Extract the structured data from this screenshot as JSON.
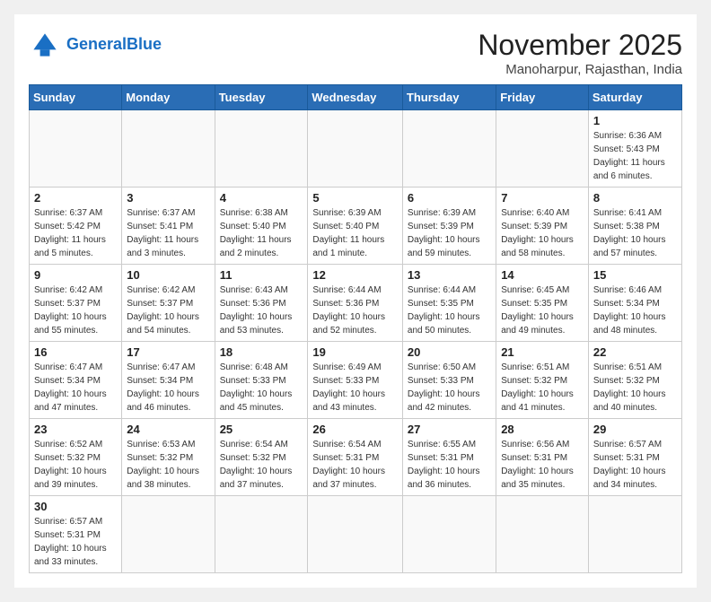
{
  "header": {
    "logo_general": "General",
    "logo_blue": "Blue",
    "month_title": "November 2025",
    "subtitle": "Manoharpur, Rajasthan, India"
  },
  "days_of_week": [
    "Sunday",
    "Monday",
    "Tuesday",
    "Wednesday",
    "Thursday",
    "Friday",
    "Saturday"
  ],
  "weeks": [
    [
      {
        "day": "",
        "info": ""
      },
      {
        "day": "",
        "info": ""
      },
      {
        "day": "",
        "info": ""
      },
      {
        "day": "",
        "info": ""
      },
      {
        "day": "",
        "info": ""
      },
      {
        "day": "",
        "info": ""
      },
      {
        "day": "1",
        "info": "Sunrise: 6:36 AM\nSunset: 5:43 PM\nDaylight: 11 hours\nand 6 minutes."
      }
    ],
    [
      {
        "day": "2",
        "info": "Sunrise: 6:37 AM\nSunset: 5:42 PM\nDaylight: 11 hours\nand 5 minutes."
      },
      {
        "day": "3",
        "info": "Sunrise: 6:37 AM\nSunset: 5:41 PM\nDaylight: 11 hours\nand 3 minutes."
      },
      {
        "day": "4",
        "info": "Sunrise: 6:38 AM\nSunset: 5:40 PM\nDaylight: 11 hours\nand 2 minutes."
      },
      {
        "day": "5",
        "info": "Sunrise: 6:39 AM\nSunset: 5:40 PM\nDaylight: 11 hours\nand 1 minute."
      },
      {
        "day": "6",
        "info": "Sunrise: 6:39 AM\nSunset: 5:39 PM\nDaylight: 10 hours\nand 59 minutes."
      },
      {
        "day": "7",
        "info": "Sunrise: 6:40 AM\nSunset: 5:39 PM\nDaylight: 10 hours\nand 58 minutes."
      },
      {
        "day": "8",
        "info": "Sunrise: 6:41 AM\nSunset: 5:38 PM\nDaylight: 10 hours\nand 57 minutes."
      }
    ],
    [
      {
        "day": "9",
        "info": "Sunrise: 6:42 AM\nSunset: 5:37 PM\nDaylight: 10 hours\nand 55 minutes."
      },
      {
        "day": "10",
        "info": "Sunrise: 6:42 AM\nSunset: 5:37 PM\nDaylight: 10 hours\nand 54 minutes."
      },
      {
        "day": "11",
        "info": "Sunrise: 6:43 AM\nSunset: 5:36 PM\nDaylight: 10 hours\nand 53 minutes."
      },
      {
        "day": "12",
        "info": "Sunrise: 6:44 AM\nSunset: 5:36 PM\nDaylight: 10 hours\nand 52 minutes."
      },
      {
        "day": "13",
        "info": "Sunrise: 6:44 AM\nSunset: 5:35 PM\nDaylight: 10 hours\nand 50 minutes."
      },
      {
        "day": "14",
        "info": "Sunrise: 6:45 AM\nSunset: 5:35 PM\nDaylight: 10 hours\nand 49 minutes."
      },
      {
        "day": "15",
        "info": "Sunrise: 6:46 AM\nSunset: 5:34 PM\nDaylight: 10 hours\nand 48 minutes."
      }
    ],
    [
      {
        "day": "16",
        "info": "Sunrise: 6:47 AM\nSunset: 5:34 PM\nDaylight: 10 hours\nand 47 minutes."
      },
      {
        "day": "17",
        "info": "Sunrise: 6:47 AM\nSunset: 5:34 PM\nDaylight: 10 hours\nand 46 minutes."
      },
      {
        "day": "18",
        "info": "Sunrise: 6:48 AM\nSunset: 5:33 PM\nDaylight: 10 hours\nand 45 minutes."
      },
      {
        "day": "19",
        "info": "Sunrise: 6:49 AM\nSunset: 5:33 PM\nDaylight: 10 hours\nand 43 minutes."
      },
      {
        "day": "20",
        "info": "Sunrise: 6:50 AM\nSunset: 5:33 PM\nDaylight: 10 hours\nand 42 minutes."
      },
      {
        "day": "21",
        "info": "Sunrise: 6:51 AM\nSunset: 5:32 PM\nDaylight: 10 hours\nand 41 minutes."
      },
      {
        "day": "22",
        "info": "Sunrise: 6:51 AM\nSunset: 5:32 PM\nDaylight: 10 hours\nand 40 minutes."
      }
    ],
    [
      {
        "day": "23",
        "info": "Sunrise: 6:52 AM\nSunset: 5:32 PM\nDaylight: 10 hours\nand 39 minutes."
      },
      {
        "day": "24",
        "info": "Sunrise: 6:53 AM\nSunset: 5:32 PM\nDaylight: 10 hours\nand 38 minutes."
      },
      {
        "day": "25",
        "info": "Sunrise: 6:54 AM\nSunset: 5:32 PM\nDaylight: 10 hours\nand 37 minutes."
      },
      {
        "day": "26",
        "info": "Sunrise: 6:54 AM\nSunset: 5:31 PM\nDaylight: 10 hours\nand 37 minutes."
      },
      {
        "day": "27",
        "info": "Sunrise: 6:55 AM\nSunset: 5:31 PM\nDaylight: 10 hours\nand 36 minutes."
      },
      {
        "day": "28",
        "info": "Sunrise: 6:56 AM\nSunset: 5:31 PM\nDaylight: 10 hours\nand 35 minutes."
      },
      {
        "day": "29",
        "info": "Sunrise: 6:57 AM\nSunset: 5:31 PM\nDaylight: 10 hours\nand 34 minutes."
      }
    ],
    [
      {
        "day": "30",
        "info": "Sunrise: 6:57 AM\nSunset: 5:31 PM\nDaylight: 10 hours\nand 33 minutes."
      },
      {
        "day": "",
        "info": ""
      },
      {
        "day": "",
        "info": ""
      },
      {
        "day": "",
        "info": ""
      },
      {
        "day": "",
        "info": ""
      },
      {
        "day": "",
        "info": ""
      },
      {
        "day": "",
        "info": ""
      }
    ]
  ]
}
